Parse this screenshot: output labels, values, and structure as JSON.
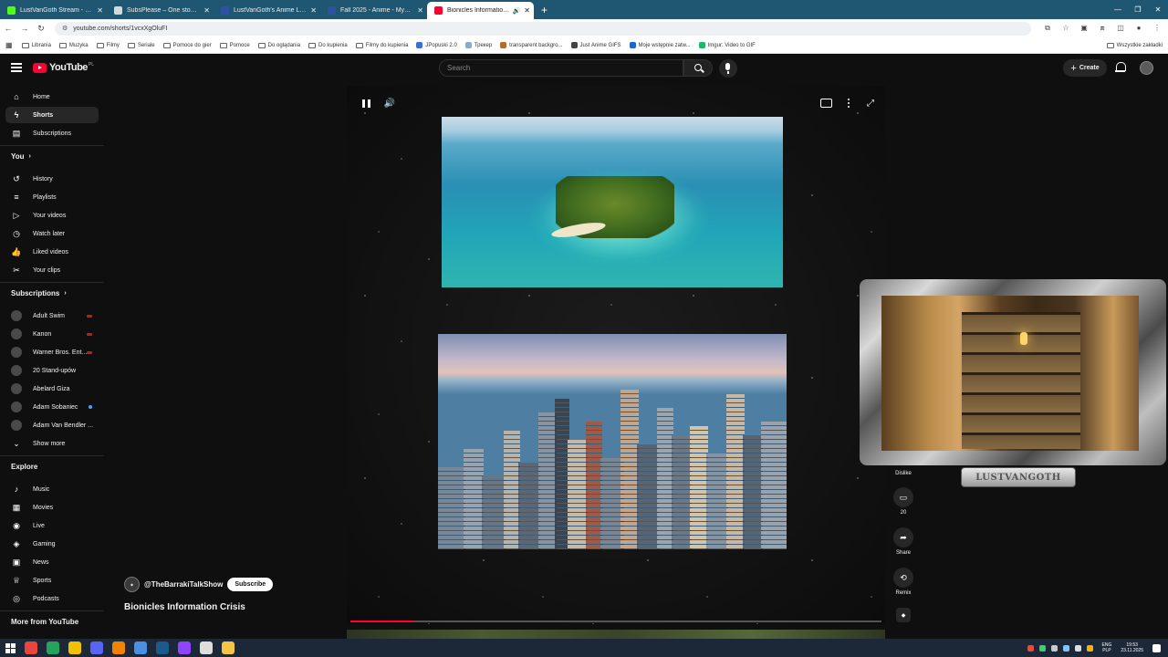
{
  "browser": {
    "tabs": [
      {
        "title": "LustVanGoth Stream - Watch Li",
        "icon_color": "#53fc18",
        "active": false
      },
      {
        "title": "SubsPlease – One stop shop fo",
        "icon_color": "#d8d8d8",
        "active": false
      },
      {
        "title": "LustVanGoth's Anime List - My",
        "icon_color": "#2e51a2",
        "active": false
      },
      {
        "title": "Fall 2025 - Anime - MyAnimeLi",
        "icon_color": "#2e51a2",
        "active": false
      },
      {
        "title": "Bionicles Information Crisis",
        "icon_color": "#ff0033",
        "active": true
      }
    ],
    "new_tab_label": "+",
    "url": "youtube.com/shorts/1vcxXgOluFI",
    "bookmarks": [
      {
        "label": "Librania",
        "type": "folder"
      },
      {
        "label": "Muzyka",
        "type": "folder"
      },
      {
        "label": "Filmy",
        "type": "folder"
      },
      {
        "label": "Seriale",
        "type": "folder"
      },
      {
        "label": "Pomoce do gier",
        "type": "folder"
      },
      {
        "label": "Pomoce",
        "type": "folder"
      },
      {
        "label": "Do oglądania",
        "type": "folder"
      },
      {
        "label": "Do kupienia",
        "type": "folder"
      },
      {
        "label": "Filmy do kupienia",
        "type": "folder"
      },
      {
        "label": "JPopuski 2.0",
        "type": "site",
        "color": "#3a6fd8"
      },
      {
        "label": "Трекер",
        "type": "site",
        "color": "#8fa8c8"
      },
      {
        "label": "transparent backgro...",
        "type": "site",
        "color": "#b56b2a"
      },
      {
        "label": "Just Anime GIFS",
        "type": "site",
        "color": "#444444"
      },
      {
        "label": "Moje wstępnie zatw...",
        "type": "site",
        "color": "#1967d2"
      },
      {
        "label": "Imgur: Video to GIF",
        "type": "site",
        "color": "#1bb76e"
      }
    ],
    "all_bookmarks_label": "Wszystkie zakładki"
  },
  "masthead": {
    "logo_text": "YouTube",
    "country_code": "PL",
    "search_placeholder": "Search",
    "create_label": "Create"
  },
  "sidebar": {
    "main": [
      {
        "label": "Home",
        "icon": "home-icon",
        "glyph": "⌂"
      },
      {
        "label": "Shorts",
        "icon": "shorts-icon",
        "glyph": "ϟ",
        "active": true
      },
      {
        "label": "Subscriptions",
        "icon": "subscriptions-icon",
        "glyph": "▤"
      }
    ],
    "you_heading": "You",
    "you": [
      {
        "label": "History",
        "icon": "history-icon",
        "glyph": "↺"
      },
      {
        "label": "Playlists",
        "icon": "playlists-icon",
        "glyph": "≡"
      },
      {
        "label": "Your videos",
        "icon": "your-videos-icon",
        "glyph": "▷"
      },
      {
        "label": "Watch later",
        "icon": "watch-later-icon",
        "glyph": "◷"
      },
      {
        "label": "Liked videos",
        "icon": "liked-videos-icon",
        "glyph": "👍"
      },
      {
        "label": "Your clips",
        "icon": "clips-icon",
        "glyph": "✂"
      }
    ],
    "subscriptions_heading": "Subscriptions",
    "subscriptions": [
      {
        "label": "Adult Swim",
        "badge": "live"
      },
      {
        "label": "Kanon",
        "badge": "live"
      },
      {
        "label": "Warner Bros. Ent...",
        "badge": "live"
      },
      {
        "label": "20 Stand-upów",
        "badge": ""
      },
      {
        "label": "Abelard Giza",
        "badge": ""
      },
      {
        "label": "Adam Sobaniec",
        "badge": "new"
      },
      {
        "label": "Adam Van Bendler ...",
        "badge": ""
      }
    ],
    "show_more_label": "Show more",
    "explore_heading": "Explore",
    "explore": [
      {
        "label": "Music",
        "icon": "music-icon",
        "glyph": "♪"
      },
      {
        "label": "Movies",
        "icon": "movies-icon",
        "glyph": "▦"
      },
      {
        "label": "Live",
        "icon": "live-icon",
        "glyph": "◉"
      },
      {
        "label": "Gaming",
        "icon": "gaming-icon",
        "glyph": "◈"
      },
      {
        "label": "News",
        "icon": "news-icon",
        "glyph": "▣"
      },
      {
        "label": "Sports",
        "icon": "sports-icon",
        "glyph": "♕"
      },
      {
        "label": "Podcasts",
        "icon": "podcasts-icon",
        "glyph": "◎"
      }
    ],
    "more_heading": "More from YouTube"
  },
  "short": {
    "channel_name": "@TheBarrakiTalkShow",
    "subscribe_label": "Subscribe",
    "title": "Bionicles Information Crisis",
    "progress": 0.12
  },
  "actions": {
    "dislike_label": "Dislike",
    "comments_count": "20",
    "share_label": "Share",
    "remix_label": "Remix"
  },
  "overlay": {
    "streamer_plate": "LUSTVANGOTH"
  },
  "taskbar": {
    "apps": [
      {
        "icon": "chrome-icon",
        "color": "#e8453c"
      },
      {
        "icon": "terminal-icon",
        "color": "#25a35a"
      },
      {
        "icon": "norton-icon",
        "color": "#f2c200"
      },
      {
        "icon": "discord-icon",
        "color": "#5865f2"
      },
      {
        "icon": "vlc-icon",
        "color": "#f08400"
      },
      {
        "icon": "browser-icon",
        "color": "#4a8fe0"
      },
      {
        "icon": "steam-icon",
        "color": "#1b5a8a"
      },
      {
        "icon": "twitch-icon",
        "color": "#8f44fd"
      },
      {
        "icon": "obs-icon",
        "color": "#dddddd"
      },
      {
        "icon": "explorer-icon",
        "color": "#f4c542"
      }
    ],
    "language": "ENG",
    "keyboard": "PLP",
    "time": "19:53",
    "date": "23.11.2025"
  }
}
